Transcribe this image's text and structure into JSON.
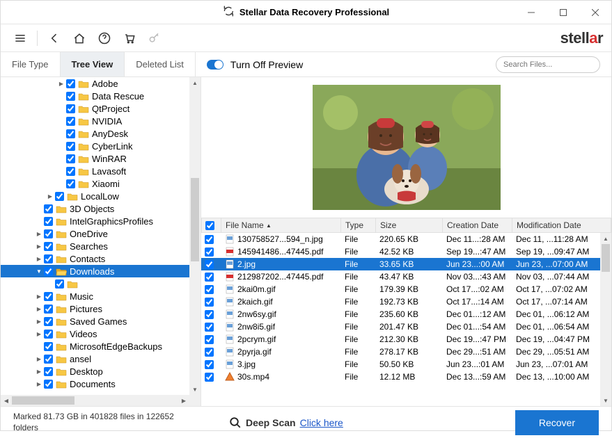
{
  "window": {
    "title": "Stellar Data Recovery Professional"
  },
  "brand": {
    "part1": "stell",
    "part2": "a",
    "part3": "r"
  },
  "tabs": {
    "file_type": "File Type",
    "tree_view": "Tree View",
    "deleted_list": "Deleted List"
  },
  "preview_toggle_label": "Turn Off Preview",
  "search": {
    "placeholder": "Search Files..."
  },
  "tree": [
    {
      "depth": 5,
      "expander": ">",
      "checked": true,
      "folder": "closed",
      "label": "Adobe"
    },
    {
      "depth": 5,
      "expander": "",
      "checked": true,
      "folder": "closed",
      "label": "Data Rescue"
    },
    {
      "depth": 5,
      "expander": "",
      "checked": true,
      "folder": "closed",
      "label": "QtProject"
    },
    {
      "depth": 5,
      "expander": "",
      "checked": true,
      "folder": "closed",
      "label": "NVIDIA"
    },
    {
      "depth": 5,
      "expander": "",
      "checked": true,
      "folder": "closed",
      "label": "AnyDesk"
    },
    {
      "depth": 5,
      "expander": "",
      "checked": true,
      "folder": "closed",
      "label": "CyberLink"
    },
    {
      "depth": 5,
      "expander": "",
      "checked": true,
      "folder": "closed",
      "label": "WinRAR"
    },
    {
      "depth": 5,
      "expander": "",
      "checked": true,
      "folder": "closed",
      "label": "Lavasoft"
    },
    {
      "depth": 5,
      "expander": "",
      "checked": true,
      "folder": "closed",
      "label": "Xiaomi"
    },
    {
      "depth": 4,
      "expander": ">",
      "checked": true,
      "folder": "closed",
      "label": "LocalLow"
    },
    {
      "depth": 3,
      "expander": "",
      "checked": true,
      "folder": "closed",
      "label": "3D Objects"
    },
    {
      "depth": 3,
      "expander": "",
      "checked": true,
      "folder": "closed",
      "label": "IntelGraphicsProfiles"
    },
    {
      "depth": 3,
      "expander": ">",
      "checked": true,
      "folder": "closed",
      "label": "OneDrive"
    },
    {
      "depth": 3,
      "expander": ">",
      "checked": true,
      "folder": "closed",
      "label": "Searches"
    },
    {
      "depth": 3,
      "expander": ">",
      "checked": true,
      "folder": "closed",
      "label": "Contacts"
    },
    {
      "depth": 3,
      "expander": "v",
      "checked": true,
      "folder": "open",
      "label": "Downloads",
      "selected": true
    },
    {
      "depth": 4,
      "expander": "",
      "checked": true,
      "folder": "closed",
      "label": ""
    },
    {
      "depth": 3,
      "expander": ">",
      "checked": true,
      "folder": "closed",
      "label": "Music"
    },
    {
      "depth": 3,
      "expander": ">",
      "checked": true,
      "folder": "closed",
      "label": "Pictures"
    },
    {
      "depth": 3,
      "expander": ">",
      "checked": true,
      "folder": "closed",
      "label": "Saved Games"
    },
    {
      "depth": 3,
      "expander": ">",
      "checked": true,
      "folder": "closed",
      "label": "Videos"
    },
    {
      "depth": 3,
      "expander": "",
      "checked": true,
      "folder": "closed",
      "label": "MicrosoftEdgeBackups"
    },
    {
      "depth": 3,
      "expander": ">",
      "checked": true,
      "folder": "closed",
      "label": "ansel"
    },
    {
      "depth": 3,
      "expander": ">",
      "checked": true,
      "folder": "closed",
      "label": "Desktop"
    },
    {
      "depth": 3,
      "expander": ">",
      "checked": true,
      "folder": "closed",
      "label": "Documents"
    }
  ],
  "table": {
    "headers": {
      "name": "File Name",
      "type": "Type",
      "size": "Size",
      "cdate": "Creation Date",
      "mdate": "Modification Date"
    },
    "rows": [
      {
        "checked": true,
        "icon": "image",
        "name": "130758527...594_n.jpg",
        "type": "File",
        "size": "220.65 KB",
        "cdate": "Dec 11...:28 AM",
        "mdate": "Dec 11, ...11:28 AM"
      },
      {
        "checked": true,
        "icon": "pdf",
        "name": "145941486...47445.pdf",
        "type": "File",
        "size": "42.52 KB",
        "cdate": "Sep 19...:47 AM",
        "mdate": "Sep 19, ...09:47 AM"
      },
      {
        "checked": true,
        "icon": "image",
        "name": "2.jpg",
        "type": "File",
        "size": "33.65 KB",
        "cdate": "Jun 23...:00 AM",
        "mdate": "Jun 23, ...07:00 AM",
        "selected": true
      },
      {
        "checked": true,
        "icon": "pdf",
        "name": "212987202...47445.pdf",
        "type": "File",
        "size": "43.47 KB",
        "cdate": "Nov 03...:43 AM",
        "mdate": "Nov 03, ...07:44 AM"
      },
      {
        "checked": true,
        "icon": "image",
        "name": "2kai0m.gif",
        "type": "File",
        "size": "179.39 KB",
        "cdate": "Oct 17...:02 AM",
        "mdate": "Oct 17, ...07:02 AM"
      },
      {
        "checked": true,
        "icon": "image",
        "name": "2kaich.gif",
        "type": "File",
        "size": "192.73 KB",
        "cdate": "Oct 17...:14 AM",
        "mdate": "Oct 17, ...07:14 AM"
      },
      {
        "checked": true,
        "icon": "image",
        "name": "2nw6sy.gif",
        "type": "File",
        "size": "235.60 KB",
        "cdate": "Dec 01...:12 AM",
        "mdate": "Dec 01, ...06:12 AM"
      },
      {
        "checked": true,
        "icon": "image",
        "name": "2nw8i5.gif",
        "type": "File",
        "size": "201.47 KB",
        "cdate": "Dec 01...:54 AM",
        "mdate": "Dec 01, ...06:54 AM"
      },
      {
        "checked": true,
        "icon": "image",
        "name": "2pcrym.gif",
        "type": "File",
        "size": "212.30 KB",
        "cdate": "Dec 19...:47 PM",
        "mdate": "Dec 19, ...04:47 PM"
      },
      {
        "checked": true,
        "icon": "image",
        "name": "2pyrja.gif",
        "type": "File",
        "size": "278.17 KB",
        "cdate": "Dec 29...:51 AM",
        "mdate": "Dec 29, ...05:51 AM"
      },
      {
        "checked": true,
        "icon": "image",
        "name": "3.jpg",
        "type": "File",
        "size": "50.50 KB",
        "cdate": "Jun 23...:01 AM",
        "mdate": "Jun 23, ...07:01 AM"
      },
      {
        "checked": true,
        "icon": "video",
        "name": "30s.mp4",
        "type": "File",
        "size": "12.12 MB",
        "cdate": "Dec 13...:59 AM",
        "mdate": "Dec 13, ...10:00 AM"
      }
    ]
  },
  "footer": {
    "status": "Marked 81.73 GB in 401828 files in 122652 folders",
    "deep_scan_label": "Deep Scan",
    "deep_scan_link": "Click here",
    "recover_label": "Recover"
  }
}
